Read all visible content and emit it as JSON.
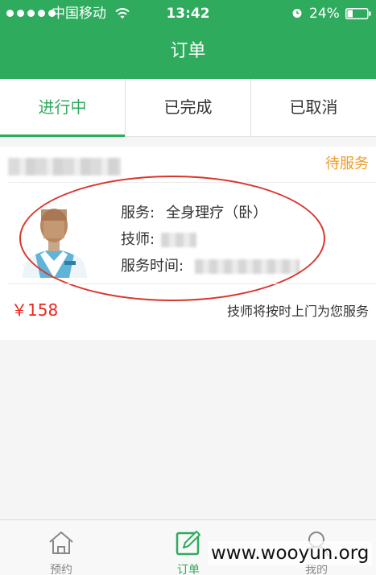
{
  "status_bar": {
    "carrier": "中国移动",
    "time": "13:42",
    "battery": "24%"
  },
  "nav": {
    "title": "订单"
  },
  "tabs": [
    {
      "label": "进行中",
      "active": true
    },
    {
      "label": "已完成",
      "active": false
    },
    {
      "label": "已取消",
      "active": false
    }
  ],
  "order": {
    "status": "待服务",
    "service_label": "服务:",
    "service_value": "全身理疗（卧）",
    "technician_label": "技师:",
    "service_time_label": "服务时间:",
    "price": "￥158",
    "note": "技师将按时上门为您服务"
  },
  "tabbar": {
    "items": [
      {
        "label": "预约",
        "icon": "home-icon",
        "active": false
      },
      {
        "label": "订单",
        "icon": "edit-icon",
        "active": true
      },
      {
        "label": "我的",
        "icon": "user-icon",
        "active": false
      }
    ]
  },
  "watermark": "www.wooyun.org",
  "colors": {
    "brand_green": "#2fab5e",
    "status_orange": "#f09b28",
    "price_red": "#e8281c",
    "highlight_red": "#d9342b"
  }
}
